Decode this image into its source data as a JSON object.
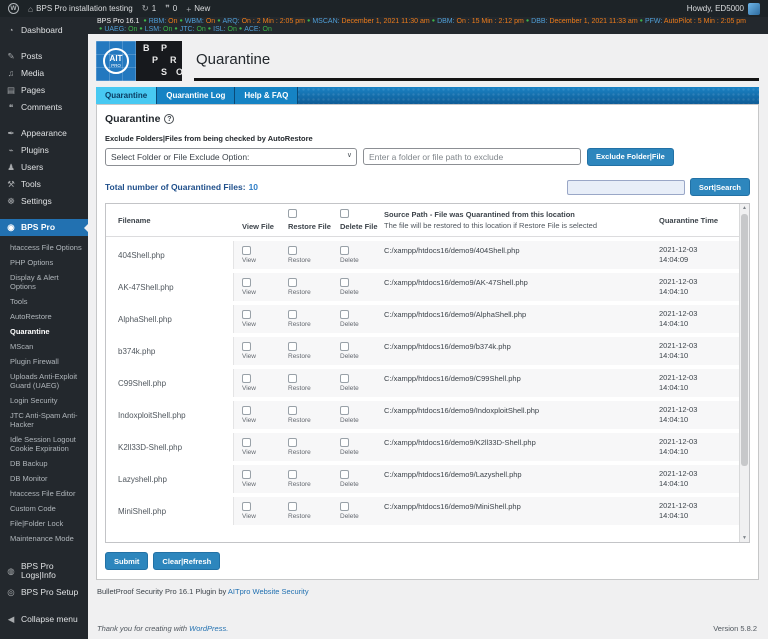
{
  "icons": {
    "wp": "W",
    "home": "⌂",
    "updates": "↻",
    "comment": "❞",
    "plus": "+",
    "dashboard": "◔",
    "posts": "✎",
    "media": "♫",
    "pages": "▤",
    "comments": "❝",
    "appearance": "✒",
    "plugins": "⌁",
    "users": "♟",
    "tools": "⚒",
    "settings": "☸",
    "bps": "◉",
    "logs": "◍",
    "setup": "◎",
    "collapse": "◀",
    "bullet": "●",
    "chevron": "∨",
    "scroll_up": "▲",
    "scroll_down": "▼",
    "question": "?"
  },
  "admin_bar": {
    "site_name": "BPS Pro installation testing",
    "updates_count": "1",
    "comments_count": "0",
    "new_label": "New",
    "howdy": "Howdy, ED5000"
  },
  "status": {
    "prefix": "BPS Pro 16.1",
    "line1": [
      {
        "label": "RBM:",
        "value": "On"
      },
      {
        "label": "WBM:",
        "value": "On"
      },
      {
        "label": "ARQ:",
        "value": "On : 2 Min : 2:05 pm"
      },
      {
        "label": "MSCAN:",
        "value": "December 1, 2021 11:30 am"
      },
      {
        "label": "DBM:",
        "value": "On : 15 Min : 2:12 pm"
      },
      {
        "label": "DBB:",
        "value": "December 1, 2021 11:33 am"
      },
      {
        "label": "PFW:",
        "value": "AutoPilot : 5 Min : 2:05 pm"
      }
    ],
    "line2": [
      {
        "label": "UAEG:",
        "value": "On"
      },
      {
        "label": "LSM:",
        "value": "On"
      },
      {
        "label": "JTC:",
        "value": "On"
      },
      {
        "label": "ISL:",
        "value": "On"
      },
      {
        "label": "ACE:",
        "value": "On"
      }
    ]
  },
  "sidebar": {
    "dashboard": "Dashboard",
    "posts": "Posts",
    "media": "Media",
    "pages": "Pages",
    "comments": "Comments",
    "appearance": "Appearance",
    "plugins": "Plugins",
    "users": "Users",
    "tools": "Tools",
    "settings": "Settings",
    "bps_pro": "BPS Pro",
    "submenu_before": [
      "htaccess File Options",
      "PHP Options",
      "Display & Alert Options",
      "Tools",
      "AutoRestore"
    ],
    "submenu_current": "Quarantine",
    "submenu_after": [
      "MScan",
      "Plugin Firewall",
      "Uploads Anti-Exploit Guard (UAEG)",
      "Login Security",
      "JTC Anti-Spam Anti-Hacker",
      "Idle Session Logout Cookie Expiration",
      "DB Backup",
      "DB Monitor",
      "htaccess File Editor",
      "Custom Code",
      "File|Folder Lock",
      "Maintenance Mode"
    ],
    "logs": "BPS Pro Logs|Info",
    "setup": "BPS Pro Setup",
    "collapse": "Collapse menu"
  },
  "header": {
    "ait_top": "AIT",
    "ait_sub": "PRO",
    "bps_letters": [
      "B",
      "P",
      "P",
      "R",
      "S",
      "O"
    ],
    "title": "Quarantine"
  },
  "tabs": {
    "quarantine": "Quarantine",
    "log": "Quarantine Log",
    "help": "Help & FAQ"
  },
  "content": {
    "section_title": "Quarantine",
    "exclude_label": "Exclude Folders|Files from being checked by AutoRestore",
    "select_value": "Select Folder or File Exclude Option:",
    "path_placeholder": "Enter a folder or file path to exclude",
    "exclude_button": "Exclude Folder|File",
    "total_label": "Total number of Quarantined Files:",
    "total_value": "10",
    "sort_button": "Sort|Search",
    "submit_button": "Submit",
    "clear_button": "Clear|Refresh",
    "credit_text": "BulletProof Security Pro 16.1 Plugin by",
    "credit_link": "AITpro Website Security"
  },
  "table": {
    "headers": {
      "filename": "Filename",
      "view": "View File",
      "restore": "Restore File",
      "delete": "Delete File",
      "source_title": "Source Path - File was Quarantined from this location",
      "source_sub": "The file will be restored to this location if Restore File is selected",
      "time": "Quarantine Time"
    },
    "action_labels": {
      "view": "View",
      "restore": "Restore",
      "delete": "Delete"
    },
    "rows": [
      {
        "filename": "404Shell.php",
        "path": "C:/xampp/htdocs16/demo9/404Shell.php",
        "date": "2021-12-03",
        "time": "14:04:09"
      },
      {
        "filename": "AK-47Shell.php",
        "path": "C:/xampp/htdocs16/demo9/AK-47Shell.php",
        "date": "2021-12-03",
        "time": "14:04:10"
      },
      {
        "filename": "AlphaShell.php",
        "path": "C:/xampp/htdocs16/demo9/AlphaShell.php",
        "date": "2021-12-03",
        "time": "14:04:10"
      },
      {
        "filename": "b374k.php",
        "path": "C:/xampp/htdocs16/demo9/b374k.php",
        "date": "2021-12-03",
        "time": "14:04:10"
      },
      {
        "filename": "C99Shell.php",
        "path": "C:/xampp/htdocs16/demo9/C99Shell.php",
        "date": "2021-12-03",
        "time": "14:04:10"
      },
      {
        "filename": "IndoxploitShell.php",
        "path": "C:/xampp/htdocs16/demo9/IndoxploitShell.php",
        "date": "2021-12-03",
        "time": "14:04:10"
      },
      {
        "filename": "K2ll33D-Shell.php",
        "path": "C:/xampp/htdocs16/demo9/K2ll33D-Shell.php",
        "date": "2021-12-03",
        "time": "14:04:10"
      },
      {
        "filename": "Lazyshell.php",
        "path": "C:/xampp/htdocs16/demo9/Lazyshell.php",
        "date": "2021-12-03",
        "time": "14:04:10"
      },
      {
        "filename": "MiniShell.php",
        "path": "C:/xampp/htdocs16/demo9/MiniShell.php",
        "date": "2021-12-03",
        "time": "14:04:10"
      }
    ]
  },
  "footer": {
    "thanks": "Thank you for creating with",
    "wp_link": "WordPress.",
    "version": "Version 5.8.2"
  },
  "colors": {
    "accent_blue": "#2271b1",
    "tab_active": "#47c9f2",
    "tab_bar": "#1583c4",
    "status_label": "#4f9fd8",
    "status_value_orange": "#ef7c1a",
    "status_value_green": "#3bb54a",
    "button": "#2d86bd",
    "admin_bar_bg": "#1d2327",
    "sidebar_bg": "#23282d"
  }
}
